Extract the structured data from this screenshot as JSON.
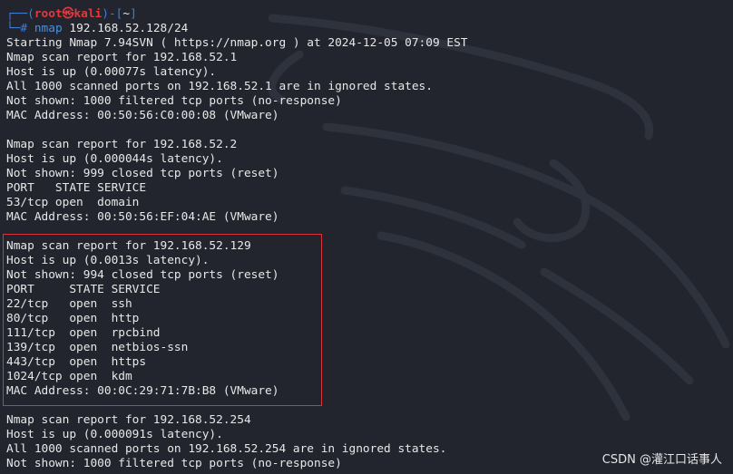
{
  "prompt": {
    "corner_top": "┌──(",
    "user_host": "root㉿kali",
    "dir_open": ")-[",
    "cwd": "~",
    "dir_close": "]",
    "corner_bottom": "└─",
    "symbol": "# ",
    "command": "nmap",
    "argument": " 192.168.52.128/24"
  },
  "output": [
    "Starting Nmap 7.94SVN ( https://nmap.org ) at 2024-12-05 07:09 EST",
    "Nmap scan report for 192.168.52.1",
    "Host is up (0.00077s latency).",
    "All 1000 scanned ports on 192.168.52.1 are in ignored states.",
    "Not shown: 1000 filtered tcp ports (no-response)",
    "MAC Address: 00:50:56:C0:00:08 (VMware)",
    "",
    "Nmap scan report for 192.168.52.2",
    "Host is up (0.000044s latency).",
    "Not shown: 999 closed tcp ports (reset)",
    "PORT   STATE SERVICE",
    "53/tcp open  domain",
    "MAC Address: 00:50:56:EF:04:AE (VMware)",
    "",
    "Nmap scan report for 192.168.52.129",
    "Host is up (0.0013s latency).",
    "Not shown: 994 closed tcp ports (reset)",
    "PORT     STATE SERVICE",
    "22/tcp   open  ssh",
    "80/tcp   open  http",
    "111/tcp  open  rpcbind",
    "139/tcp  open  netbios-ssn",
    "443/tcp  open  https",
    "1024/tcp open  kdm",
    "MAC Address: 00:0C:29:71:7B:B8 (VMware)",
    "",
    "Nmap scan report for 192.168.52.254",
    "Host is up (0.000091s latency).",
    "All 1000 scanned ports on 192.168.52.254 are in ignored states.",
    "Not shown: 1000 filtered tcp ports (no-response)"
  ],
  "watermark": "CSDN @灌江口话事人",
  "colors": {
    "background": "#22252e",
    "text": "#e8e8e8",
    "prompt_frame": "#3f7fd6",
    "prompt_user": "#e0393e",
    "highlight_box": "#d8323a"
  }
}
